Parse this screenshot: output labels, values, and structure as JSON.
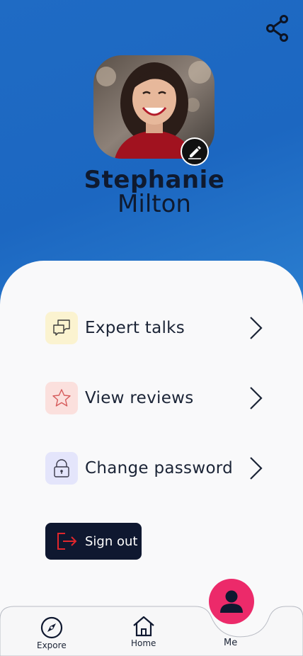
{
  "profile": {
    "first_name": "Stephanie",
    "last_name": "Milton",
    "avatar": "profile-photo"
  },
  "header": {
    "share_icon": "share-icon",
    "edit_icon": "pencil-icon"
  },
  "menu": {
    "items": [
      {
        "label": "Expert talks",
        "icon": "chat-bubbles-icon",
        "icon_bg": "#fbf3d0"
      },
      {
        "label": "View reviews",
        "icon": "star-icon",
        "icon_bg": "#fbe0dd"
      },
      {
        "label": "Change password",
        "icon": "lock-icon",
        "icon_bg": "#e4e5fb"
      }
    ]
  },
  "signout": {
    "label": "Sign out",
    "icon": "sign-out-icon"
  },
  "tabbar": {
    "tabs": [
      {
        "label": "Expore",
        "icon": "compass-icon"
      },
      {
        "label": "Home",
        "icon": "home-icon"
      },
      {
        "label": "Me",
        "icon": "user-icon",
        "active": true
      }
    ]
  },
  "colors": {
    "header_blue": "#1f6bc4",
    "accent_pink": "#ec2a6a",
    "navy": "#0f1830",
    "signout_icon_red": "#e0262c"
  }
}
